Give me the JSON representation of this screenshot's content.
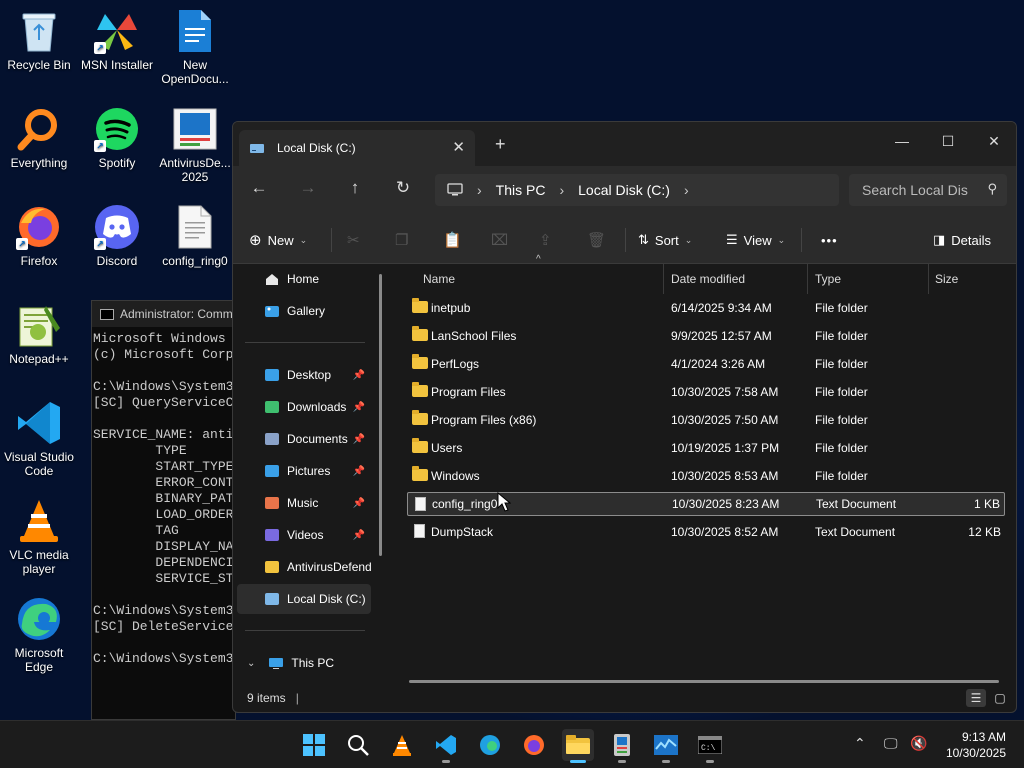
{
  "desktop": {
    "icons": [
      {
        "label": "Recycle Bin",
        "icon": "recycle-bin-icon"
      },
      {
        "label": "MSN Installer",
        "icon": "msn-icon"
      },
      {
        "label": "New OpenDocu...",
        "icon": "document-icon"
      },
      {
        "label": "Everything",
        "icon": "everything-icon"
      },
      {
        "label": "Spotify",
        "icon": "spotify-icon"
      },
      {
        "label": "AntivirusDe... 2025",
        "icon": "antivirus-icon"
      },
      {
        "label": "Firefox",
        "icon": "firefox-icon"
      },
      {
        "label": "Discord",
        "icon": "discord-icon"
      },
      {
        "label": "config_ring0",
        "icon": "text-file-icon"
      },
      {
        "label": "Notepad++",
        "icon": "notepadpp-icon"
      },
      {
        "label": "Visual Studio Code",
        "icon": "vscode-icon"
      },
      {
        "label": "VLC media player",
        "icon": "vlc-icon"
      },
      {
        "label": "Microsoft Edge",
        "icon": "edge-icon"
      }
    ]
  },
  "cmd": {
    "title": "Administrator: Comm",
    "lines": [
      "Microsoft Windows",
      "(c) Microsoft Corp",
      "",
      "C:\\Windows\\System3",
      "[SC] QueryServiceC",
      "",
      "SERVICE_NAME: anti",
      "        TYPE",
      "        START_TYPE",
      "        ERROR_CONT",
      "        BINARY_PAT",
      "        LOAD_ORDER",
      "        TAG",
      "        DISPLAY_NA",
      "        DEPENDENCI",
      "        SERVICE_ST",
      "",
      "C:\\Windows\\System3",
      "[SC] DeleteService",
      "",
      "C:\\Windows\\System3"
    ]
  },
  "explorer": {
    "tab_title": "Local Disk (C:)",
    "new_tab": "+",
    "window_controls": {
      "minimize": "—",
      "maximize": "☐",
      "close": "✕"
    },
    "breadcrumb": [
      "This PC",
      "Local Disk (C:)"
    ],
    "search_placeholder": "Search Local Dis",
    "toolbar": {
      "new": "New",
      "sort": "Sort",
      "view": "View",
      "more": "•••",
      "details": "Details"
    },
    "nav": {
      "home": "Home",
      "gallery": "Gallery",
      "quick": [
        {
          "label": "Desktop",
          "color": "#3aa0e8"
        },
        {
          "label": "Downloads",
          "color": "#3fbf6f"
        },
        {
          "label": "Documents",
          "color": "#8aa2c8"
        },
        {
          "label": "Pictures",
          "color": "#3aa0e8"
        },
        {
          "label": "Music",
          "color": "#e8744a"
        },
        {
          "label": "Videos",
          "color": "#7a6ae0"
        },
        {
          "label": "AntivirusDefend",
          "color": "#f2c33e"
        },
        {
          "label": "Local Disk (C:)",
          "color": "#7fb8e8"
        }
      ],
      "this_pc": "This PC"
    },
    "columns": {
      "name": "Name",
      "date": "Date modified",
      "type": "Type",
      "size": "Size"
    },
    "files": [
      {
        "name": "inetpub",
        "date": "6/14/2025 9:34 AM",
        "type": "File folder",
        "size": "",
        "kind": "folder"
      },
      {
        "name": "LanSchool Files",
        "date": "9/9/2025 12:57 AM",
        "type": "File folder",
        "size": "",
        "kind": "folder"
      },
      {
        "name": "PerfLogs",
        "date": "4/1/2024 3:26 AM",
        "type": "File folder",
        "size": "",
        "kind": "folder"
      },
      {
        "name": "Program Files",
        "date": "10/30/2025 7:58 AM",
        "type": "File folder",
        "size": "",
        "kind": "folder"
      },
      {
        "name": "Program Files (x86)",
        "date": "10/30/2025 7:50 AM",
        "type": "File folder",
        "size": "",
        "kind": "folder"
      },
      {
        "name": "Users",
        "date": "10/19/2025 1:37 PM",
        "type": "File folder",
        "size": "",
        "kind": "folder"
      },
      {
        "name": "Windows",
        "date": "10/30/2025 8:53 AM",
        "type": "File folder",
        "size": "",
        "kind": "folder"
      },
      {
        "name": "config_ring0",
        "date": "10/30/2025 8:23 AM",
        "type": "Text Document",
        "size": "1 KB",
        "kind": "doc",
        "selected": true
      },
      {
        "name": "DumpStack",
        "date": "10/30/2025 8:52 AM",
        "type": "Text Document",
        "size": "12 KB",
        "kind": "doc"
      }
    ],
    "status": "9 items"
  },
  "taskbar": {
    "time": "9:13 AM",
    "date": "10/30/2025"
  }
}
